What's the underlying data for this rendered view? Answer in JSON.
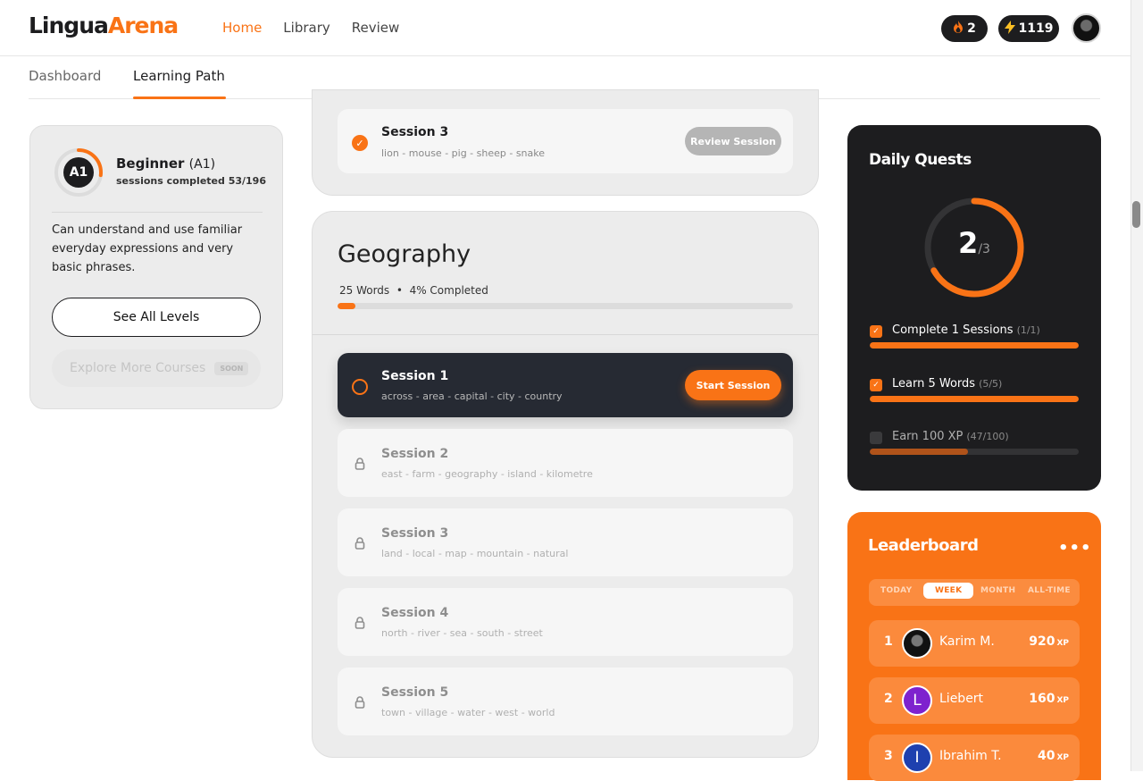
{
  "app": {
    "logo_part1": "Lingua",
    "logo_part2": "Arena",
    "nav": [
      "Home",
      "Library",
      "Review"
    ],
    "streak": "2",
    "xp": "1119"
  },
  "tabs": [
    "Dashboard",
    "Learning Path"
  ],
  "level": {
    "badge": "A1",
    "name": "Beginner",
    "code": "(A1)",
    "progress_text": "sessions completed 53/196",
    "progress_fraction": 0.27,
    "description": "Can understand and use familiar everyday expressions and very basic phrases.",
    "see_all": "See All Levels",
    "explore": "Explore More Courses",
    "soon": "SOON"
  },
  "prev_unit": {
    "session": {
      "title": "Session 3",
      "words": "lion - mouse - pig - sheep - snake",
      "button": "Review Session"
    }
  },
  "unit": {
    "title": "Geography",
    "words_count": "25 Words",
    "completed": "4% Completed",
    "progress_fraction": 0.04,
    "sessions": [
      {
        "title": "Session 1",
        "words": "across - area - capital - city - country",
        "button": "Start Session",
        "state": "active"
      },
      {
        "title": "Session 2",
        "words": "east - farm - geography - island - kilometre",
        "state": "locked"
      },
      {
        "title": "Session 3",
        "words": "land - local - map - mountain - natural",
        "state": "locked"
      },
      {
        "title": "Session 4",
        "words": "north - river - sea - south - street",
        "state": "locked"
      },
      {
        "title": "Session 5",
        "words": "town - village - water - west - world",
        "state": "locked"
      }
    ]
  },
  "quests": {
    "title": "Daily Quests",
    "done": "2",
    "total": "/3",
    "fraction": 0.667,
    "items": [
      {
        "label": "Complete 1 Sessions",
        "progress": "(1/1)",
        "fraction": 1.0,
        "done": true
      },
      {
        "label": "Learn 5 Words",
        "progress": "(5/5)",
        "fraction": 1.0,
        "done": true
      },
      {
        "label": "Earn 100 XP",
        "progress": "(47/100)",
        "fraction": 0.47,
        "done": false
      }
    ]
  },
  "leaderboard": {
    "title": "Leaderboard",
    "more": "•••",
    "tabs": [
      "TODAY",
      "WEEK",
      "MONTH",
      "ALL-TIME"
    ],
    "active_tab": "WEEK",
    "unit": "XP",
    "rows": [
      {
        "rank": "1",
        "name": "Karim M.",
        "xp": "920",
        "initial": "",
        "color": "#1d1d1f"
      },
      {
        "rank": "2",
        "name": "Liebert",
        "xp": "160",
        "initial": "L",
        "color": "#7e22ce"
      },
      {
        "rank": "3",
        "name": "Ibrahim T.",
        "xp": "40",
        "initial": "I",
        "color": "#1e40af"
      }
    ]
  },
  "colors": {
    "accent": "#f97316",
    "dark": "#1d1d1f"
  }
}
